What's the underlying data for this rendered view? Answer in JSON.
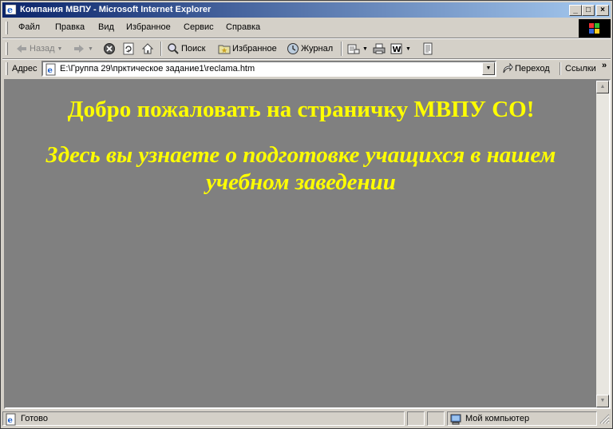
{
  "window": {
    "title": "Компания МВПУ - Microsoft Internet Explorer"
  },
  "menu": {
    "items": [
      "Файл",
      "Правка",
      "Вид",
      "Избранное",
      "Сервис",
      "Справка"
    ]
  },
  "toolbar": {
    "back_label": "Назад",
    "search_label": "Поиск",
    "favorites_label": "Избранное",
    "history_label": "Журнал"
  },
  "address": {
    "label": "Адрес",
    "value": "E:\\Группа 29\\прктическое задание1\\reclama.htm",
    "go_label": "Переход",
    "links_label": "Ссылки",
    "links_chevron": "»"
  },
  "page": {
    "heading": "Добро пожаловать на страничку МВПУ СО!",
    "subheading_line1": "Здесь вы узнаете о подготовке учащихся в нашем",
    "subheading_line2": "учебном заведении",
    "background": "#808080",
    "text_color": "#ffff00"
  },
  "status": {
    "text": "Готово",
    "zone": "Мой компьютер"
  }
}
